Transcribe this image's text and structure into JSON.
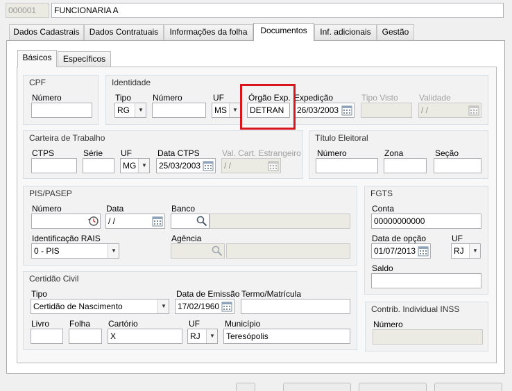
{
  "header": {
    "code": "000001",
    "name": "FUNCIONARIA A"
  },
  "tabs": [
    "Dados Cadastrais",
    "Dados Contratuais",
    "Informações da folha",
    "Documentos",
    "Inf. adicionais",
    "Gestão"
  ],
  "active_tab": "Documentos",
  "subtabs": [
    "Básicos",
    "Específicos"
  ],
  "cpf": {
    "title": "CPF",
    "numero_label": "Número",
    "numero": ""
  },
  "identidade": {
    "title": "Identidade",
    "tipo_label": "Tipo",
    "tipo": "RG",
    "numero_label": "Número",
    "numero": "",
    "uf_label": "UF",
    "uf": "MS",
    "orgao_label": "Órgão Exp.",
    "orgao": "DETRAN",
    "expedicao_label": "Expedição",
    "expedicao": "26/03/2003",
    "tipo_visto_label": "Tipo Visto",
    "tipo_visto": "",
    "validade_label": "Validade",
    "validade": " /  /"
  },
  "carteira": {
    "title": "Carteira de Trabalho",
    "ctps_label": "CTPS",
    "ctps": "",
    "serie_label": "Série",
    "serie": "",
    "uf_label": "UF",
    "uf": "MG",
    "data_label": "Data CTPS",
    "data": "25/03/2003",
    "val_label": "Val. Cart. Estrangeiro",
    "val": " /  /"
  },
  "titulo": {
    "title": "Título Eleitoral",
    "numero_label": "Número",
    "numero": "",
    "zona_label": "Zona",
    "zona": "",
    "secao_label": "Seção",
    "secao": ""
  },
  "pis": {
    "title": "PIS/PASEP",
    "numero_label": "Número",
    "numero": "",
    "data_label": "Data",
    "data": " /  /",
    "banco_label": "Banco",
    "banco": "",
    "banco_nome": "",
    "rais_label": "Identificação RAIS",
    "rais": "0 - PIS",
    "agencia_label": "Agência",
    "agencia": "",
    "agencia_nome": ""
  },
  "fgts": {
    "title": "FGTS",
    "conta_label": "Conta",
    "conta": "00000000000",
    "data_label": "Data de opção",
    "data": "01/07/2013",
    "uf_label": "UF",
    "uf": "RJ",
    "saldo_label": "Saldo",
    "saldo": ""
  },
  "certidao": {
    "title": "Certidão Civil",
    "tipo_label": "Tipo",
    "tipo": "Certidão de Nascimento",
    "emissao_label": "Data de Emissão",
    "emissao": "17/02/1960",
    "termo_label": "Termo/Matrícula",
    "termo": "",
    "livro_label": "Livro",
    "livro": "",
    "folha_label": "Folha",
    "folha": "",
    "cartorio_label": "Cartório",
    "cartorio": "X",
    "uf_label": "UF",
    "uf": "RJ",
    "municipio_label": "Município",
    "municipio": "Teresópolis"
  },
  "inss": {
    "title": "Contrib. Individual INSS",
    "numero_label": "Número",
    "numero": ""
  },
  "colors": {
    "highlight": "#d9141b",
    "input_border": "#abadb3",
    "disabled": "#ebebe4"
  }
}
